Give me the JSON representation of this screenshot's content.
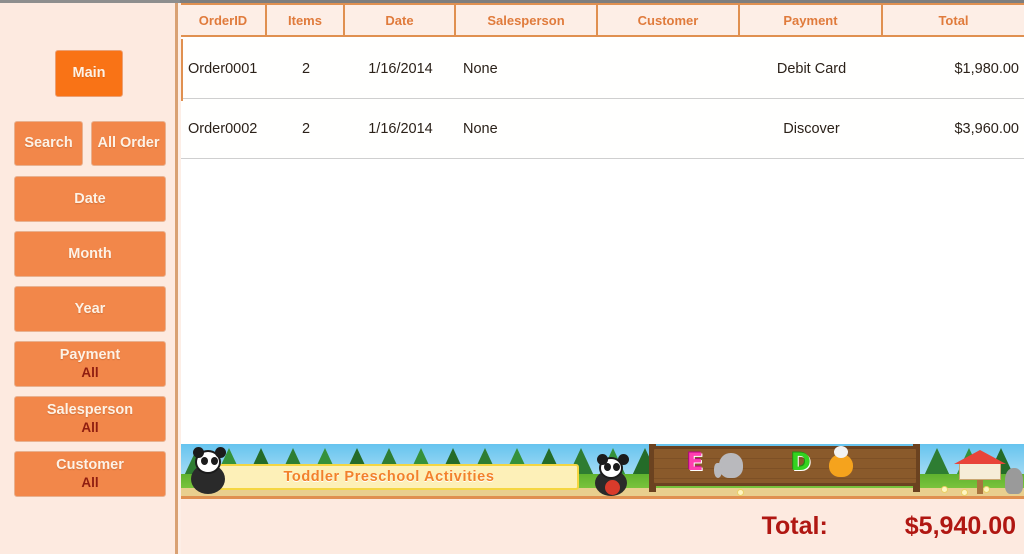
{
  "app": {
    "accent_orange": "#f2874a",
    "accent_orange_active": "#f97316",
    "header_text_color": "#e07b3c",
    "total_color": "#b01712",
    "sidebar_bg": "#fdeae0"
  },
  "sidebar": {
    "main_button": {
      "label": "Main",
      "active": true
    },
    "search_button": {
      "label": "Search"
    },
    "all_order_button": {
      "label": "All Order"
    },
    "filters": [
      {
        "label": "Date",
        "value": ""
      },
      {
        "label": "Month",
        "value": ""
      },
      {
        "label": "Year",
        "value": ""
      },
      {
        "label": "Payment",
        "value": "All"
      },
      {
        "label": "Salesperson",
        "value": "All"
      },
      {
        "label": "Customer",
        "value": "All"
      }
    ]
  },
  "table": {
    "columns": [
      {
        "key": "orderid",
        "label": "OrderID"
      },
      {
        "key": "items",
        "label": "Items"
      },
      {
        "key": "date",
        "label": "Date"
      },
      {
        "key": "salesperson",
        "label": "Salesperson"
      },
      {
        "key": "customer",
        "label": "Customer"
      },
      {
        "key": "payment",
        "label": "Payment"
      },
      {
        "key": "total",
        "label": "Total"
      }
    ],
    "rows": [
      {
        "orderid": "Order0001",
        "items": "2",
        "date": "1/16/2014",
        "salesperson": "None",
        "customer": "",
        "payment": "Debit Card",
        "total": "$1,980.00"
      },
      {
        "orderid": "Order0002",
        "items": "2",
        "date": "1/16/2014",
        "salesperson": "None",
        "customer": "",
        "payment": "Discover",
        "total": "$3,960.00"
      }
    ]
  },
  "ad_banner": {
    "title": "Toddler Preschool Activities",
    "sign_letters": [
      "E",
      "D"
    ],
    "icons": [
      "panda-icon",
      "elephant-icon",
      "duck-icon",
      "birdhouse-icon"
    ]
  },
  "footer": {
    "total_label": "Total:",
    "total_value": "$5,940.00"
  }
}
